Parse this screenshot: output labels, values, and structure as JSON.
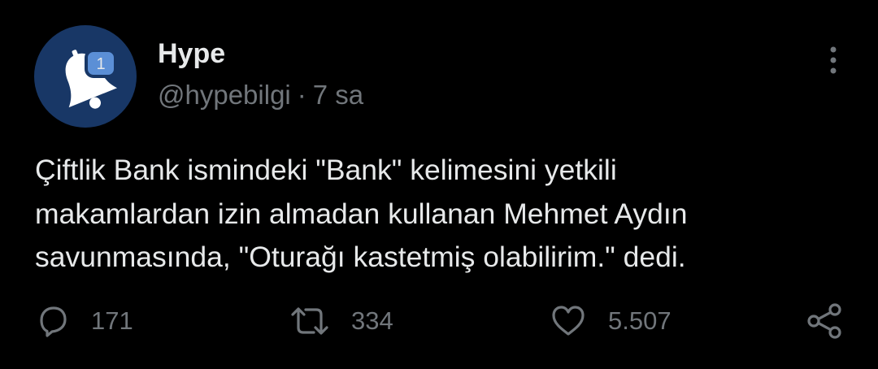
{
  "tweet": {
    "author": {
      "display_name": "Hype",
      "handle": "@hypebilgi",
      "separator": "·",
      "time": "7 sa",
      "avatar_badge": "1",
      "avatar_icon": "bell-icon"
    },
    "text": "Çiftlik Bank ismindeki \"Bank\" kelimesini yetkili\nmakamlardan izin almadan kullanan Mehmet Aydın\nsavunmasında, \"Oturağı kastetmiş olabilirim.\" dedi.",
    "actions": {
      "reply": {
        "icon": "reply-icon",
        "count": "171"
      },
      "retweet": {
        "icon": "retweet-icon",
        "count": "334"
      },
      "like": {
        "icon": "heart-icon",
        "count": "5.507"
      },
      "share": {
        "icon": "share-icon"
      }
    },
    "more_icon": "more-vertical-icon"
  },
  "colors": {
    "background": "#000000",
    "primary_text": "#e7e9ea",
    "secondary_text": "#71767b",
    "avatar_bg": "#183766",
    "badge_bg": "#5b8fd6"
  }
}
